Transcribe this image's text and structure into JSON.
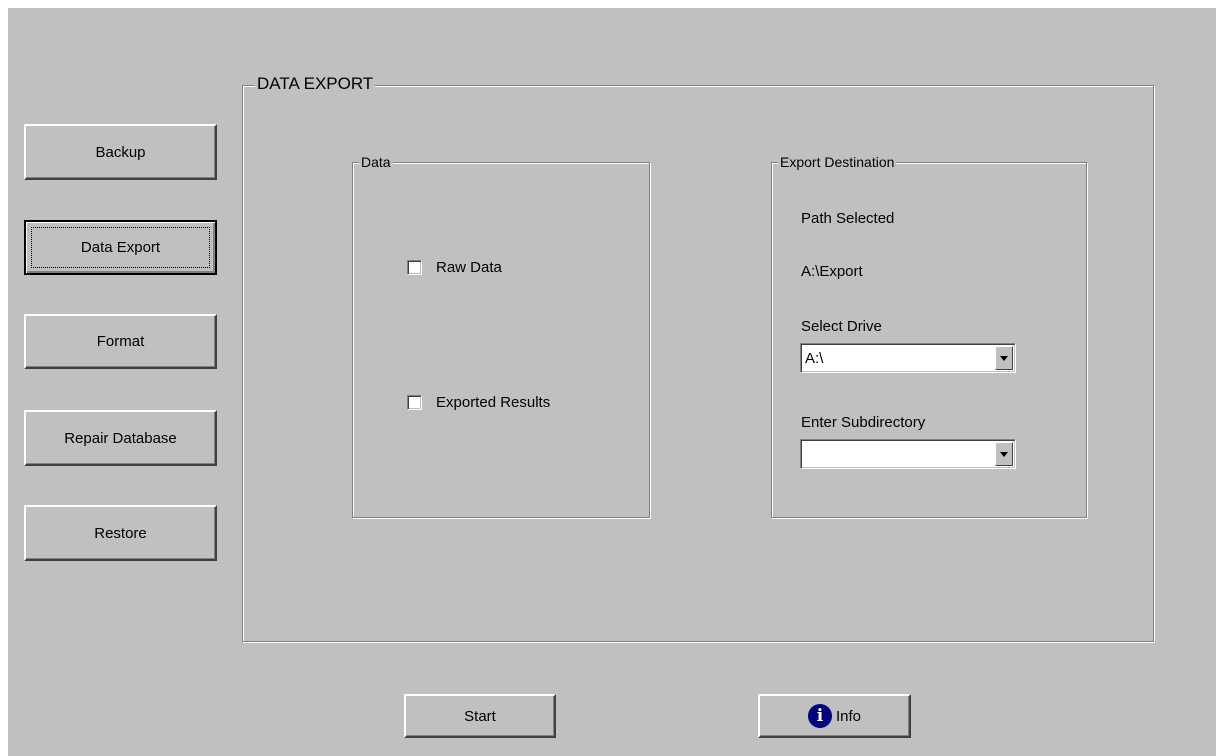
{
  "sidebar": {
    "buttons": [
      {
        "label": "Backup",
        "mnemonic": "B"
      },
      {
        "label": "Data Export",
        "mnemonic": "E"
      },
      {
        "label": "Format",
        "mnemonic": "F"
      },
      {
        "label": "Repair Database",
        "mnemonic": "D"
      },
      {
        "label": "Restore",
        "mnemonic": "R"
      }
    ]
  },
  "panel": {
    "title": "DATA EXPORT"
  },
  "data_group": {
    "title": "Data",
    "raw_data": {
      "label": "Raw Data",
      "checked": false
    },
    "exported_results": {
      "label": "Exported Results",
      "checked": false
    }
  },
  "export_group": {
    "title": "Export Destination",
    "path_selected_label": "Path Selected",
    "path_value": "A:\\Export",
    "select_drive_label": "Select Drive",
    "drive_value": "A:\\",
    "subdirectory_label": "Enter Subdirectory",
    "subdirectory_value": ""
  },
  "footer": {
    "start_label": "Start",
    "info_label": "Info",
    "info_icon": "info-icon"
  }
}
